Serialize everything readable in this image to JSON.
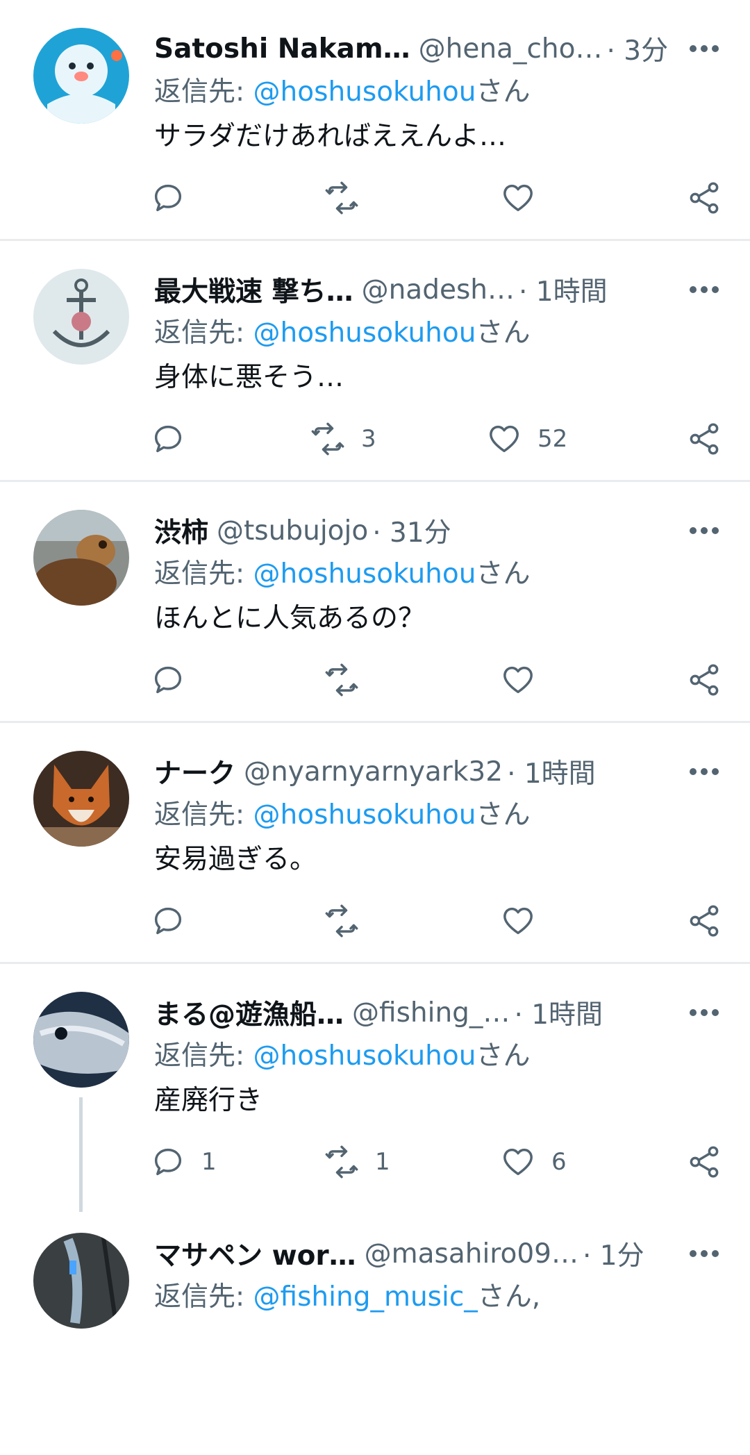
{
  "tweets": [
    {
      "name": "Satoshi Nakam…",
      "handle": "@hena_cho…",
      "time": "· 3分",
      "reply_prefix": "返信先: ",
      "reply_mention": "@hoshusokuhou",
      "reply_suffix": "さん",
      "text": "サラダだけあればええんよ…",
      "reply_count": "",
      "retweet_count": "",
      "like_count": ""
    },
    {
      "name": "最大戦速 撃ち…",
      "handle": "@nadesh…",
      "time": "· 1時間",
      "reply_prefix": "返信先: ",
      "reply_mention": "@hoshusokuhou",
      "reply_suffix": "さん",
      "text": "身体に悪そう…",
      "reply_count": "",
      "retweet_count": "3",
      "like_count": "52"
    },
    {
      "name": "渋柿",
      "handle": "@tsubujojo",
      "time": "· 31分",
      "reply_prefix": "返信先: ",
      "reply_mention": "@hoshusokuhou",
      "reply_suffix": "さん",
      "text": "ほんとに人気あるの？",
      "reply_count": "",
      "retweet_count": "",
      "like_count": ""
    },
    {
      "name": "ナーク",
      "handle": "@nyarnyarnyark32",
      "time": "· 1時間",
      "reply_prefix": "返信先: ",
      "reply_mention": "@hoshusokuhou",
      "reply_suffix": "さん",
      "text": "安易過ぎる。",
      "reply_count": "",
      "retweet_count": "",
      "like_count": ""
    },
    {
      "name": "まる@遊漁船…",
      "handle": "@fishing_…",
      "time": "· 1時間",
      "reply_prefix": "返信先: ",
      "reply_mention": "@hoshusokuhou",
      "reply_suffix": "さん",
      "text": "産廃行き",
      "reply_count": "1",
      "retweet_count": "1",
      "like_count": "6"
    },
    {
      "name": "マサペン wor…",
      "handle": "@masahiro09…",
      "time": "· 1分",
      "reply_prefix": "返信先: ",
      "reply_mention": "@fishing_music_",
      "reply_suffix": "さん,",
      "text": "",
      "reply_count": "",
      "retweet_count": "",
      "like_count": ""
    }
  ],
  "icons": {
    "reply": "reply-icon",
    "retweet": "retweet-icon",
    "like": "heart-icon",
    "share": "share-icon",
    "more": "more-icon"
  },
  "colors": {
    "accent": "#1d9bf0",
    "secondary_text": "#536471",
    "primary_text": "#0f1419",
    "divider": "#e9ecef",
    "thread_line": "#cfd9de"
  }
}
